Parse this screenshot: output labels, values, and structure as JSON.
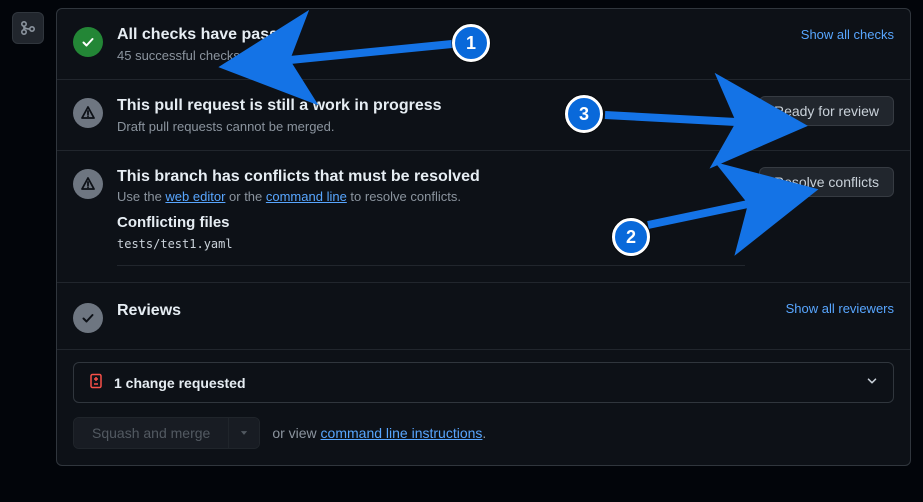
{
  "checks": {
    "title": "All checks have passed",
    "subtitle": "45 successful checks",
    "show_all": "Show all checks"
  },
  "draft": {
    "title": "This pull request is still a work in progress",
    "subtitle": "Draft pull requests cannot be merged.",
    "button": "Ready for review"
  },
  "conflicts": {
    "title": "This branch has conflicts that must be resolved",
    "prefix": "Use the ",
    "web_editor": "web editor",
    "middle": " or the ",
    "command_line": "command line",
    "suffix": " to resolve conflicts.",
    "files_heading": "Conflicting files",
    "file1": "tests/test1.yaml",
    "button": "Resolve conflicts"
  },
  "reviews": {
    "title": "Reviews",
    "show_all": "Show all reviewers",
    "changes_requested": "1 change requested"
  },
  "merge": {
    "button": "Squash and merge",
    "or_view": "or view ",
    "cli_link": "command line instructions",
    "period": "."
  },
  "annotations": {
    "a1": "1",
    "a2": "2",
    "a3": "3"
  }
}
